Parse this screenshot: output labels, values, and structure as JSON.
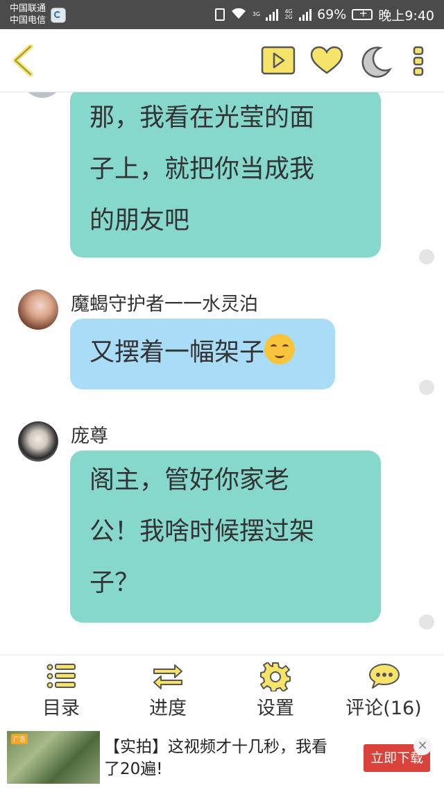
{
  "status_bar": {
    "carrier_1": "中国联通",
    "carrier_2": "中国电信",
    "network_1": "3G",
    "network_2": "4G 2G",
    "battery": "69%",
    "time": "晚上9:40"
  },
  "toolbar": {
    "back_icon": "chevron-left-icon",
    "play_icon": "play-icon",
    "like_icon": "heart-icon",
    "night_icon": "moon-icon",
    "more_icon": "more-vertical-icon",
    "accent_color": "#f5e469"
  },
  "messages": [
    {
      "speaker": "",
      "text_lines": [
        "那，我看在光莹的面",
        "子上，就把你当成我",
        "的朋友吧"
      ],
      "bubble_color": "#86d8cd"
    },
    {
      "speaker": "魔蝎守护者一一水灵泊",
      "text_lines": [
        "又摆着一幅架子"
      ],
      "emoji": "smirk-emoji",
      "bubble_color": "#a9dcf6"
    },
    {
      "speaker": "庞尊",
      "text_lines": [
        "阁主，管好你家老",
        "公！我啥时候摆过架",
        "子？"
      ],
      "bubble_color": "#86d8cd"
    }
  ],
  "bottom_nav": [
    {
      "label": "目录",
      "icon": "list-icon"
    },
    {
      "label": "进度",
      "icon": "swap-arrows-icon"
    },
    {
      "label": "设置",
      "icon": "gear-icon"
    },
    {
      "label": "评论(16)",
      "icon": "comment-icon"
    }
  ],
  "ad": {
    "badge": "广告",
    "text": "【实拍】这视频才十几秒，我看了20遍!",
    "button": "立即下载",
    "close": "✕"
  }
}
